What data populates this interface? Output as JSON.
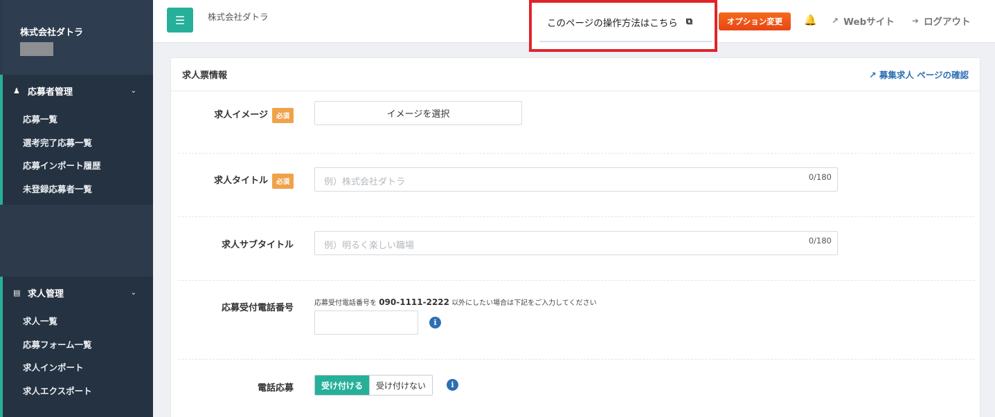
{
  "sidebar": {
    "company": "株式会社ダトラ",
    "sections": [
      {
        "title": "応募者管理",
        "icon": "users-icon",
        "items": [
          "応募一覧",
          "選考完了応募一覧",
          "応募インポート履歴",
          "未登録応募者一覧"
        ]
      },
      {
        "title": "求人管理",
        "icon": "id-card-icon",
        "items": [
          "求人一覧",
          "応募フォーム一覧",
          "求人インポート",
          "求人エクスポート"
        ]
      }
    ]
  },
  "header": {
    "company": "株式会社ダトラ",
    "help_link": "このページの操作方法はこちら",
    "option_button": "オプション変更",
    "web_link": "Webサイト",
    "logout": "ログアウト"
  },
  "panel": {
    "title": "求人票情報",
    "confirm_link": "募集求人 ページの確認",
    "required_badge": "必須",
    "fields": {
      "image": {
        "label": "求人イメージ",
        "button": "イメージを選択"
      },
      "title": {
        "label": "求人タイトル",
        "placeholder": "例）株式会社ダトラ",
        "counter": "0/180"
      },
      "subtitle": {
        "label": "求人サブタイトル",
        "placeholder": "例）明るく楽しい職場",
        "counter": "0/180"
      },
      "phone": {
        "label": "応募受付電話番号",
        "hint_prefix": "応募受付電話番号を",
        "hint_number": "090-1111-2222",
        "hint_suffix": "以外にしたい場合は下記をご入力してください"
      },
      "phone_apply": {
        "label": "電話応募",
        "option_on": "受け付ける",
        "option_off": "受け付けない"
      }
    }
  },
  "colors": {
    "accent": "#26b09a",
    "sidebar": "#2c3a4b",
    "link": "#2d6fb3",
    "highlight": "#e0232b",
    "option": "#e94515"
  }
}
